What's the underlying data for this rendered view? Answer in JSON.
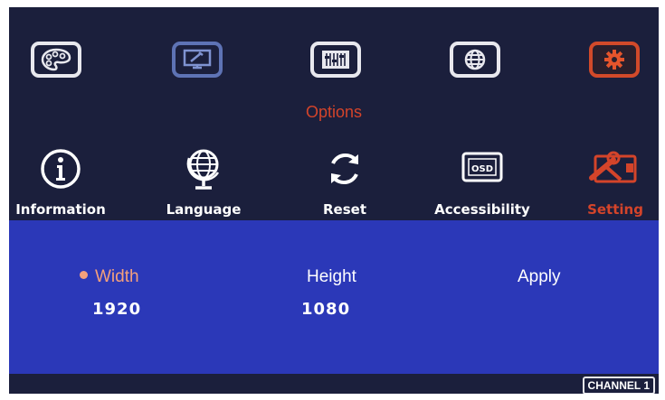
{
  "menu": {
    "tiles": [
      {
        "icon": "palette-icon",
        "state": "normal"
      },
      {
        "icon": "monitor-tools-icon",
        "state": "dim"
      },
      {
        "icon": "sliders-icon",
        "state": "normal"
      },
      {
        "icon": "globe-icon",
        "state": "normal"
      },
      {
        "icon": "gear-icon",
        "state": "active"
      }
    ],
    "section_title": "Options"
  },
  "submenu": {
    "items": [
      {
        "label": "Information",
        "icon": "info-icon",
        "state": "normal"
      },
      {
        "label": "Language",
        "icon": "globe-stand-icon",
        "state": "normal"
      },
      {
        "label": "Reset",
        "icon": "reset-icon",
        "state": "normal"
      },
      {
        "label": "Accessibility",
        "icon": "osd-icon",
        "state": "normal"
      },
      {
        "label": "Setting",
        "icon": "tools-icon",
        "state": "active"
      }
    ]
  },
  "panel": {
    "width_label": "Width",
    "height_label": "Height",
    "apply_label": "Apply",
    "width_value": "1920",
    "height_value": "1080"
  },
  "status": {
    "channel": "CHANNEL 1"
  },
  "colors": {
    "background": "#1b1f3c",
    "panel": "#2b38b8",
    "accent": "#d4442a",
    "selected": "#f4a07c"
  }
}
